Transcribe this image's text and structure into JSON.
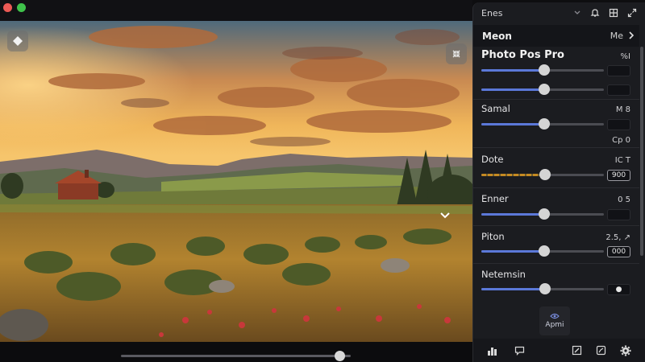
{
  "window": {
    "title_bar_colors": {
      "close": "#ec5a55",
      "zoom": "#3fc34b"
    }
  },
  "canvas": {
    "image": "landscape painting of farmland at sunset",
    "top_left_button_icon": "diamond-arrow-icon",
    "top_right_button_icon": "collapse-icon",
    "overlay_icon": "chevron-down-icon",
    "scrubber_position": 0.95
  },
  "panel": {
    "title": "Enes",
    "header_icons": [
      "chevron-down-icon",
      "bell-icon",
      "grid-icon"
    ],
    "menu": {
      "label": "Meon",
      "value": "Me",
      "icon": "chevron-right-icon"
    },
    "sections": [
      {
        "label": "Photo Pos Pro",
        "value": "%I",
        "sliders": [
          {
            "level": 0.51,
            "box": ""
          },
          {
            "level": 0.51,
            "box": ""
          }
        ]
      },
      {
        "label": "Samal",
        "value": "M 8",
        "sliders": [
          {
            "level": 0.51,
            "box": ""
          }
        ],
        "extra": "Cp 0"
      },
      {
        "label": "Dote",
        "value": "IC T",
        "sliders": [
          {
            "level": 0.52,
            "box": "900",
            "style": "amber"
          }
        ]
      },
      {
        "label": "Enner",
        "value": "0 5",
        "sliders": [
          {
            "level": 0.51,
            "box": ""
          }
        ]
      },
      {
        "label": "Piton",
        "value": "2.5, ↗",
        "sliders": [
          {
            "level": 0.51,
            "box": "000"
          }
        ]
      },
      {
        "label": "Netemsin",
        "value": "",
        "sliders": [
          {
            "level": 0.52,
            "box": "●"
          }
        ]
      }
    ],
    "apply_label": "Apmi",
    "apply_icon": "eye-icon",
    "bottom_icons": [
      "bar-chart-icon",
      "comment-icon",
      "edit-icon",
      "image-edit-icon",
      "gear-icon"
    ],
    "accent": "#5b78d8"
  }
}
